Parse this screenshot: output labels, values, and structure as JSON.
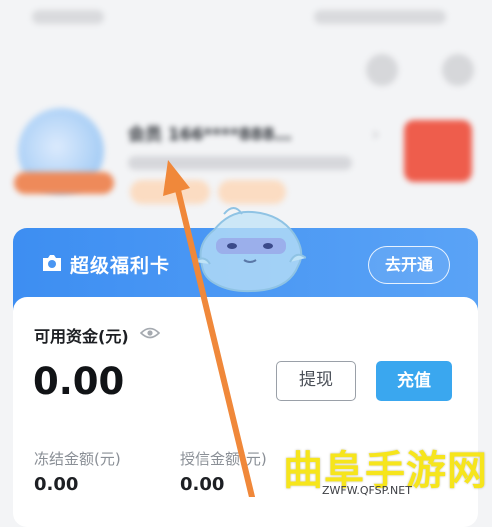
{
  "header": {
    "user_name": "会员 166****888…",
    "chevron": "›"
  },
  "banner": {
    "title": "超级福利卡",
    "open_button": "去开通",
    "icon": "camera-icon"
  },
  "wallet": {
    "available_label": "可用资金(元)",
    "available_amount": "0.00",
    "withdraw_button": "提现",
    "recharge_button": "充值",
    "frozen_label": "冻结金额(元)",
    "frozen_value": "0.00",
    "credit_label": "授信金额(元)",
    "credit_value": "0.00"
  },
  "watermark": {
    "title": "曲阜手游网",
    "url": "ZWFW.QFSP.NET"
  },
  "colors": {
    "banner": "#4595f3",
    "recharge": "#3aa7ef",
    "arrow": "#f0883a",
    "watermark": "#f6e51c"
  }
}
